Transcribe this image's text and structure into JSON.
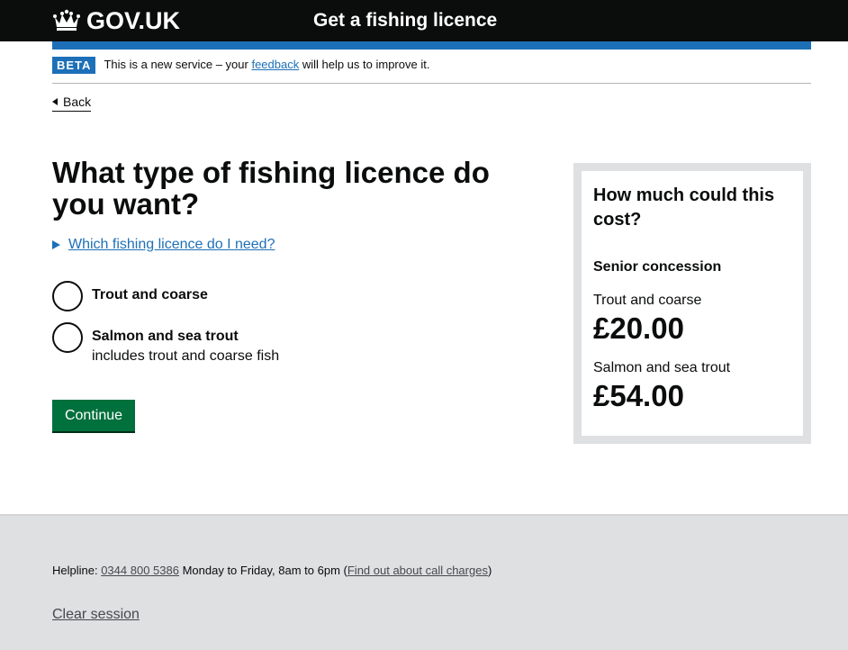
{
  "header": {
    "logo_text": "GOV.UK",
    "logo_icon": "crown-icon",
    "service_name": "Get a fishing licence"
  },
  "phase_banner": {
    "tag": "BETA",
    "text_before": "This is a new service – your ",
    "link": "feedback",
    "text_after": " will help us to improve it."
  },
  "back_link": "Back",
  "main": {
    "heading": "What type of fishing licence do you want?",
    "details_summary": "Which fishing licence do I need?",
    "options": [
      {
        "label": "Trout and coarse",
        "hint": ""
      },
      {
        "label": "Salmon and sea trout",
        "hint": "includes trout and coarse fish"
      }
    ],
    "continue_button": "Continue"
  },
  "cost_panel": {
    "title": "How much could this cost?",
    "subtitle": "Senior concession",
    "prices": [
      {
        "label": "Trout and coarse",
        "amount": "£20.00"
      },
      {
        "label": "Salmon and sea trout",
        "amount": "£54.00"
      }
    ]
  },
  "footer": {
    "helpline_label": "Helpline: ",
    "phone": "0344 800 5386",
    "hours": " Monday to Friday, 8am to 6pm (",
    "call_charges_link": "Find out about call charges",
    "close_paren": ")",
    "clear_session": "Clear session"
  },
  "colors": {
    "header_bg": "#0b0c0c",
    "accent_blue": "#1d70b8",
    "button_green": "#00703c",
    "panel_grey": "#dee0e2"
  }
}
